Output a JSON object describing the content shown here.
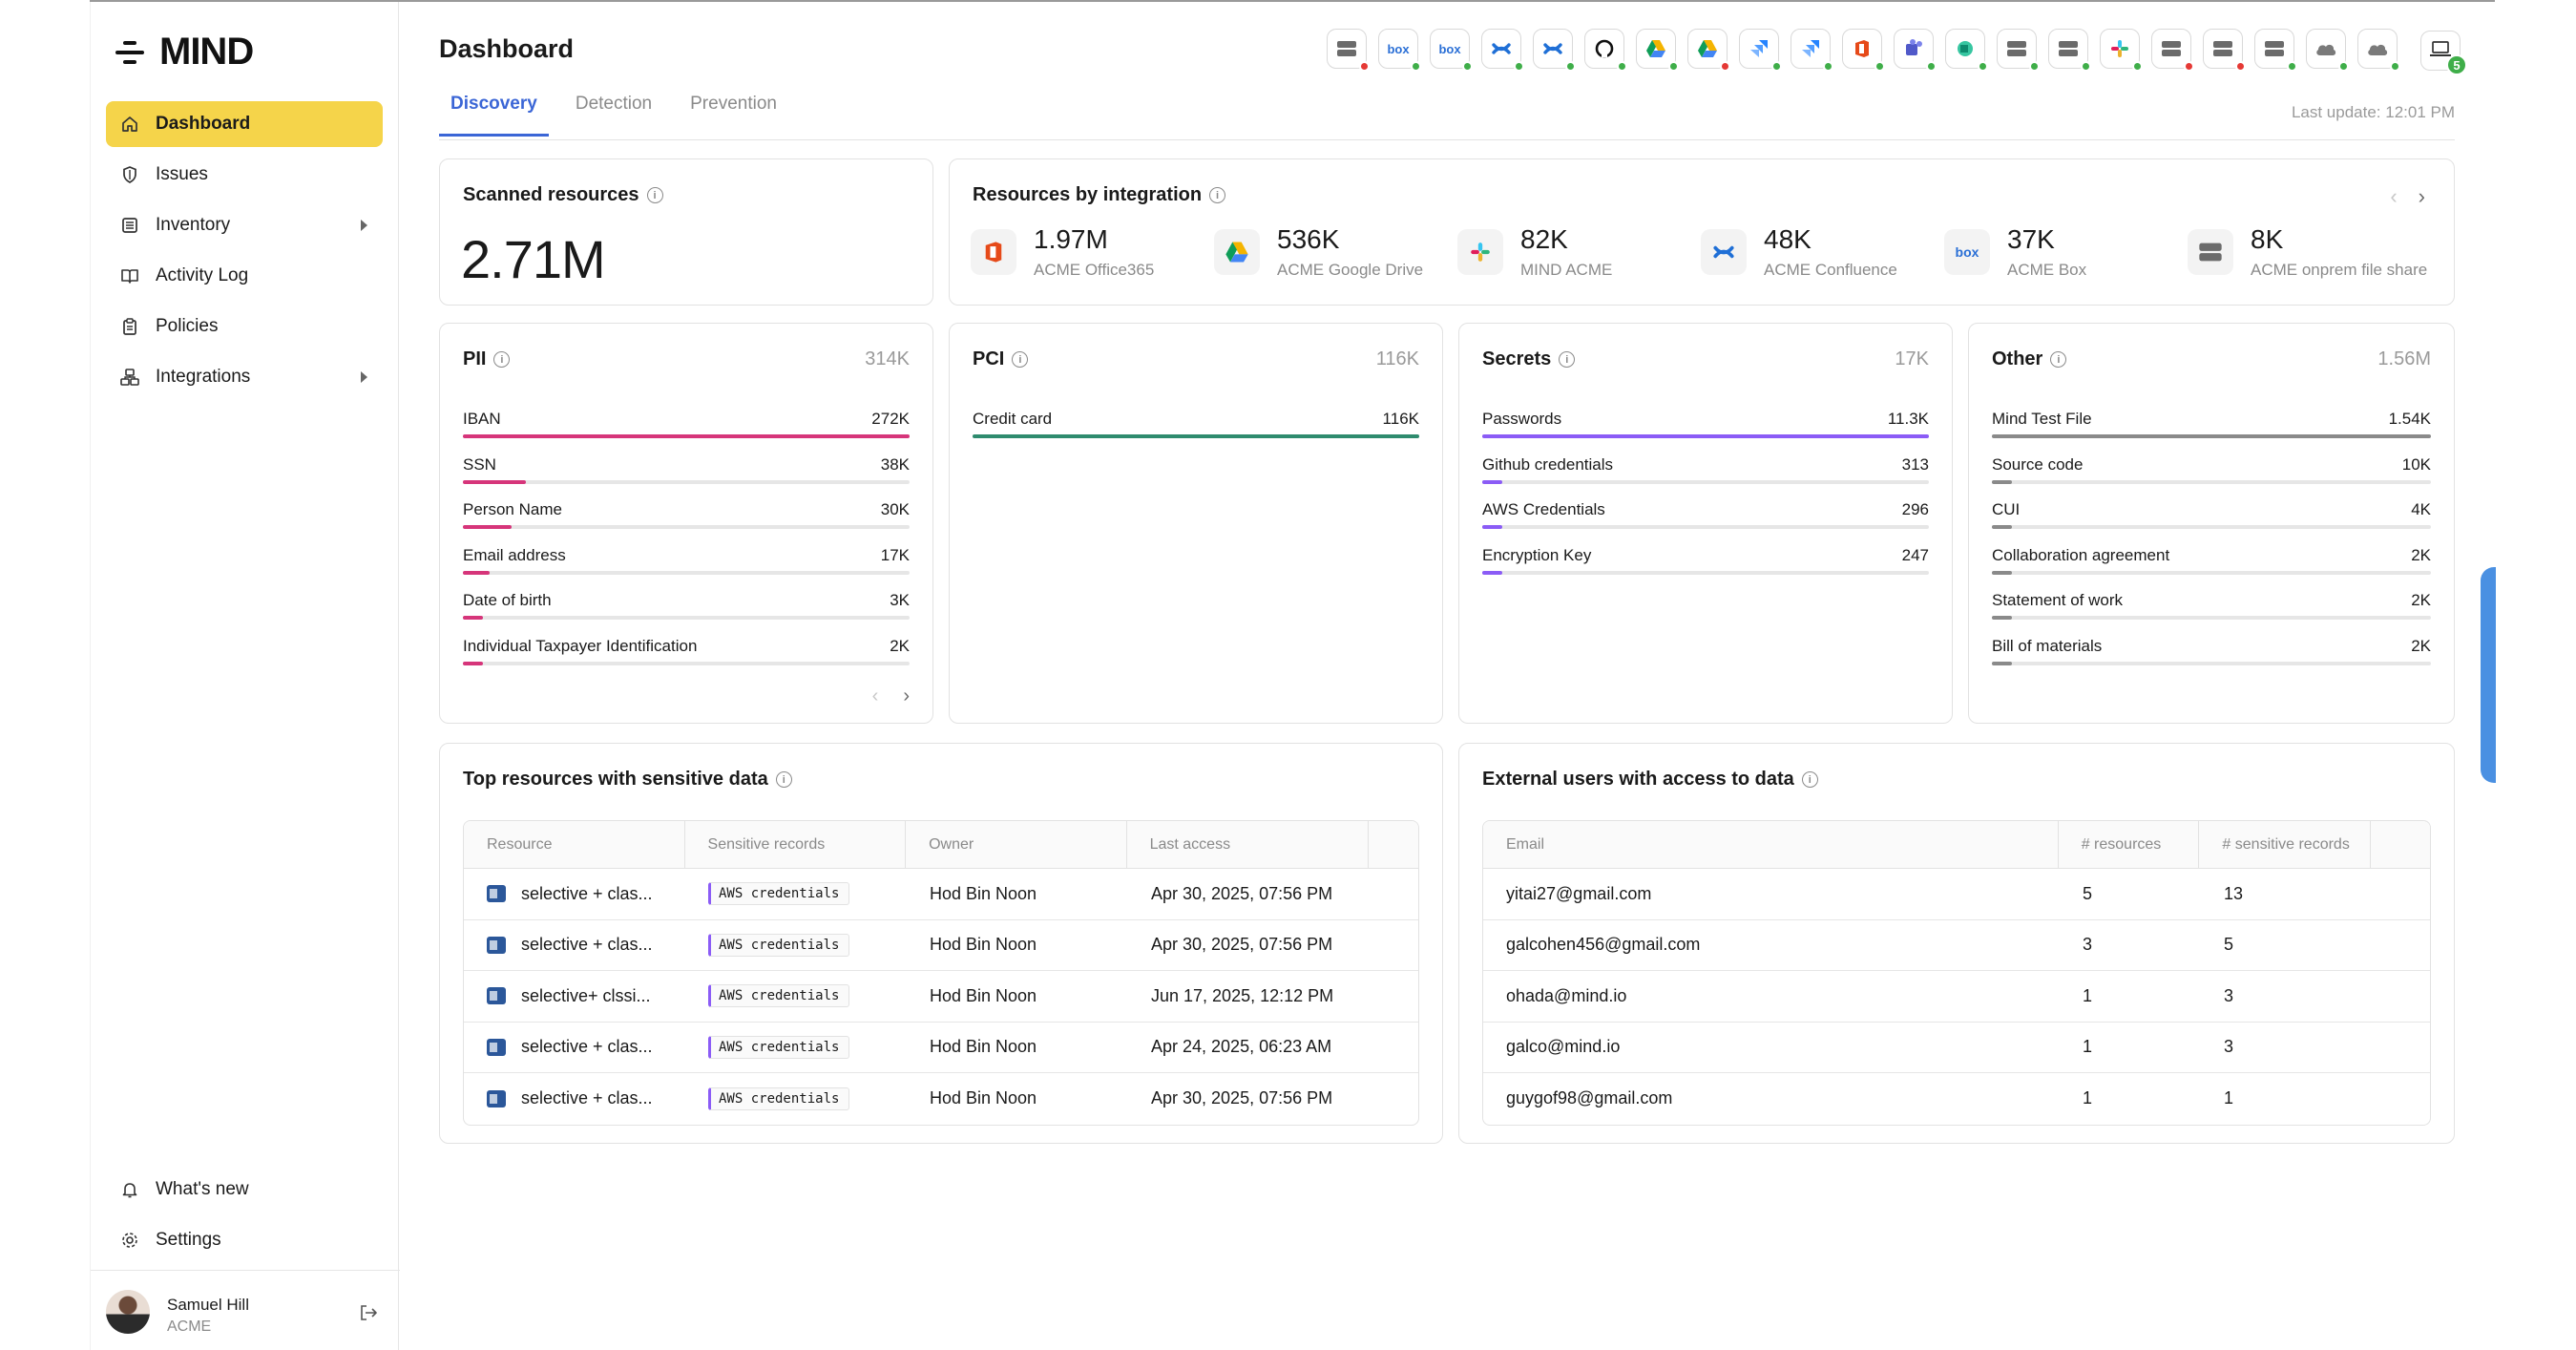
{
  "brand": {
    "name": "MIND"
  },
  "sidebar": {
    "items": [
      {
        "label": "Dashboard",
        "icon": "home-icon",
        "active": true,
        "expandable": false
      },
      {
        "label": "Issues",
        "icon": "shield-icon",
        "active": false,
        "expandable": false
      },
      {
        "label": "Inventory",
        "icon": "inventory-icon",
        "active": false,
        "expandable": true
      },
      {
        "label": "Activity Log",
        "icon": "book-icon",
        "active": false,
        "expandable": false
      },
      {
        "label": "Policies",
        "icon": "clipboard-icon",
        "active": false,
        "expandable": false
      },
      {
        "label": "Integrations",
        "icon": "integrations-icon",
        "active": false,
        "expandable": true
      }
    ],
    "bottom_items": [
      {
        "label": "What's new",
        "icon": "bell-icon"
      },
      {
        "label": "Settings",
        "icon": "gear-icon"
      }
    ],
    "user": {
      "name": "Samuel Hill",
      "org": "ACME"
    }
  },
  "header": {
    "title": "Dashboard",
    "tabs": [
      "Discovery",
      "Detection",
      "Prevention"
    ],
    "active_tab": "Discovery",
    "last_update": "Last update: 12:01 PM",
    "device_count": "5",
    "integration_icons": [
      {
        "name": "file-server-icon",
        "status": "red"
      },
      {
        "name": "box-icon",
        "status": "green"
      },
      {
        "name": "box-icon",
        "status": "green"
      },
      {
        "name": "confluence-icon",
        "status": "green"
      },
      {
        "name": "confluence-icon",
        "status": "green"
      },
      {
        "name": "github-icon",
        "status": "green"
      },
      {
        "name": "google-drive-icon",
        "status": "green"
      },
      {
        "name": "google-drive-icon",
        "status": "red"
      },
      {
        "name": "jira-icon",
        "status": "green"
      },
      {
        "name": "jira-icon",
        "status": "green"
      },
      {
        "name": "office365-icon",
        "status": "green"
      },
      {
        "name": "teams-icon",
        "status": "green"
      },
      {
        "name": "sharepoint-icon",
        "status": "green"
      },
      {
        "name": "file-server-icon",
        "status": "green"
      },
      {
        "name": "file-server-icon",
        "status": "green"
      },
      {
        "name": "slack-icon",
        "status": "green"
      },
      {
        "name": "file-server-icon",
        "status": "red"
      },
      {
        "name": "file-server-icon",
        "status": "red"
      },
      {
        "name": "file-server-icon",
        "status": "green"
      },
      {
        "name": "cloud-icon",
        "status": "green"
      },
      {
        "name": "cloud-icon",
        "status": "green"
      }
    ]
  },
  "scanned": {
    "title": "Scanned resources",
    "value": "2.71M"
  },
  "by_integration": {
    "title": "Resources by integration",
    "items": [
      {
        "value": "1.97M",
        "name": "ACME Office365",
        "icon": "office365-icon"
      },
      {
        "value": "536K",
        "name": "ACME Google Drive",
        "icon": "google-drive-icon"
      },
      {
        "value": "82K",
        "name": "MIND ACME",
        "icon": "slack-icon"
      },
      {
        "value": "48K",
        "name": "ACME Confluence",
        "icon": "confluence-icon"
      },
      {
        "value": "37K",
        "name": "ACME Box",
        "icon": "box-icon"
      },
      {
        "value": "8K",
        "name": "ACME onprem file share",
        "icon": "file-server-icon"
      }
    ]
  },
  "categories": [
    {
      "title": "PII",
      "total": "314K",
      "color": "#d6357a",
      "rows": [
        {
          "label": "IBAN",
          "value": "272K",
          "fraction": 1.0
        },
        {
          "label": "SSN",
          "value": "38K",
          "fraction": 0.14
        },
        {
          "label": "Person Name",
          "value": "30K",
          "fraction": 0.11
        },
        {
          "label": "Email address",
          "value": "17K",
          "fraction": 0.06
        },
        {
          "label": "Date of birth",
          "value": "3K",
          "fraction": 0.045
        },
        {
          "label": "Individual Taxpayer Identification",
          "value": "2K",
          "fraction": 0.045
        }
      ]
    },
    {
      "title": "PCI",
      "total": "116K",
      "color": "#2e8b6e",
      "rows": [
        {
          "label": "Credit card",
          "value": "116K",
          "fraction": 1.0
        }
      ]
    },
    {
      "title": "Secrets",
      "total": "17K",
      "color": "#8b5cf6",
      "rows": [
        {
          "label": "Passwords",
          "value": "11.3K",
          "fraction": 1.0
        },
        {
          "label": "Github credentials",
          "value": "313",
          "fraction": 0.045
        },
        {
          "label": "AWS Credentials",
          "value": "296",
          "fraction": 0.045
        },
        {
          "label": "Encryption Key",
          "value": "247",
          "fraction": 0.045
        }
      ]
    },
    {
      "title": "Other",
      "total": "1.56M",
      "color": "#8a8a8a",
      "rows": [
        {
          "label": "Mind Test File",
          "value": "1.54K",
          "fraction": 1.0
        },
        {
          "label": "Source code",
          "value": "10K",
          "fraction": 0.045
        },
        {
          "label": "CUI",
          "value": "4K",
          "fraction": 0.045
        },
        {
          "label": "Collaboration agreement",
          "value": "2K",
          "fraction": 0.045
        },
        {
          "label": "Statement of work",
          "value": "2K",
          "fraction": 0.045
        },
        {
          "label": "Bill of materials",
          "value": "2K",
          "fraction": 0.045
        }
      ]
    }
  ],
  "top_resources": {
    "title": "Top resources with sensitive data",
    "columns": [
      "Resource",
      "Sensitive records",
      "Owner",
      "Last access"
    ],
    "rows": [
      {
        "resource": "selective + clas...",
        "tag": "AWS credentials",
        "owner": "Hod Bin Noon",
        "last_access": "Apr 30, 2025, 07:56 PM"
      },
      {
        "resource": "selective + clas...",
        "tag": "AWS credentials",
        "owner": "Hod Bin Noon",
        "last_access": "Apr 30, 2025, 07:56 PM"
      },
      {
        "resource": "selective+ clssi...",
        "tag": "AWS credentials",
        "owner": "Hod Bin Noon",
        "last_access": "Jun 17, 2025, 12:12 PM"
      },
      {
        "resource": "selective + clas...",
        "tag": "AWS credentials",
        "owner": "Hod Bin Noon",
        "last_access": "Apr 24, 2025, 06:23 AM"
      },
      {
        "resource": "selective + clas...",
        "tag": "AWS credentials",
        "owner": "Hod Bin Noon",
        "last_access": "Apr 30, 2025, 07:56 PM"
      }
    ]
  },
  "external_users": {
    "title": "External users with access to data",
    "columns": [
      "Email",
      "# resources",
      "# sensitive records"
    ],
    "rows": [
      {
        "email": "yitai27@gmail.com",
        "resources": "5",
        "records": "13"
      },
      {
        "email": "galcohen456@gmail.com",
        "resources": "3",
        "records": "5"
      },
      {
        "email": "ohada@mind.io",
        "resources": "1",
        "records": "3"
      },
      {
        "email": "galco@mind.io",
        "resources": "1",
        "records": "3"
      },
      {
        "email": "guygof98@gmail.com",
        "resources": "1",
        "records": "1"
      }
    ]
  }
}
